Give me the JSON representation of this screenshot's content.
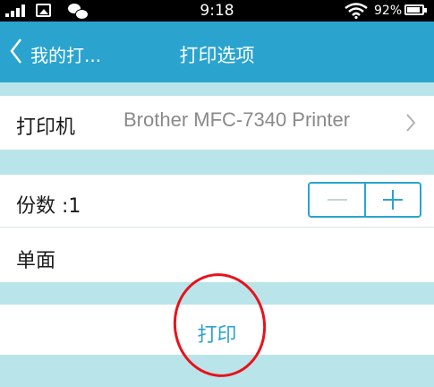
{
  "status_bar": {
    "time": "9:18",
    "battery": "92%",
    "icons": [
      "signal-icon",
      "image-icon",
      "wechat-icon",
      "wifi-icon",
      "battery-icon"
    ]
  },
  "nav": {
    "back_label": "我的打...",
    "title": "打印选项"
  },
  "printer_row": {
    "label": "打印机",
    "value": "Brother MFC-7340 Printer"
  },
  "copies_row": {
    "label": "份数 :1",
    "decrement": "−",
    "increment": "+"
  },
  "sides_row": {
    "label": "单面"
  },
  "print_button": {
    "label": "打印"
  },
  "colors": {
    "accent": "#2aa4ce",
    "band": "#b9e5ea",
    "annotation": "#e8121c"
  }
}
